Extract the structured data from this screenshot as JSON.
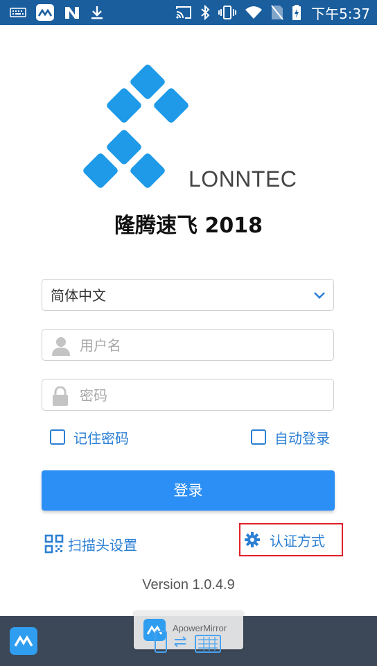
{
  "status_bar": {
    "time": "下午5:37",
    "left_icons": [
      "keyboard-icon",
      "apowermirror-icon",
      "n-app-icon",
      "download-icon"
    ],
    "right_icons": [
      "cast-icon",
      "bluetooth-icon",
      "vibrate-icon",
      "wifi-icon",
      "no-sim-icon",
      "battery-charging-icon"
    ]
  },
  "logo": {
    "brand_text": "LONNTEC",
    "color": "#1e9ae8"
  },
  "app_title": "隆腾速飞 2018",
  "language_select": {
    "selected": "简体中文"
  },
  "username_field": {
    "placeholder": "用户名",
    "value": ""
  },
  "password_field": {
    "placeholder": "密码",
    "value": ""
  },
  "remember_password": {
    "label": "记住密码",
    "checked": false
  },
  "auto_login": {
    "label": "自动登录",
    "checked": false
  },
  "login_button": {
    "label": "登录"
  },
  "scan_settings": {
    "label": "扫描头设置"
  },
  "auth_method": {
    "label": "认证方式"
  },
  "version": "Version 1.0.4.9",
  "mirror_overlay": {
    "label": "ApowerMirror"
  },
  "colors": {
    "accent": "#2b7fd4",
    "button": "#2c8ff5",
    "status_bar": "#1a5e9e",
    "highlight_border": "#e0202a",
    "bottom_bar": "#3c4858"
  }
}
